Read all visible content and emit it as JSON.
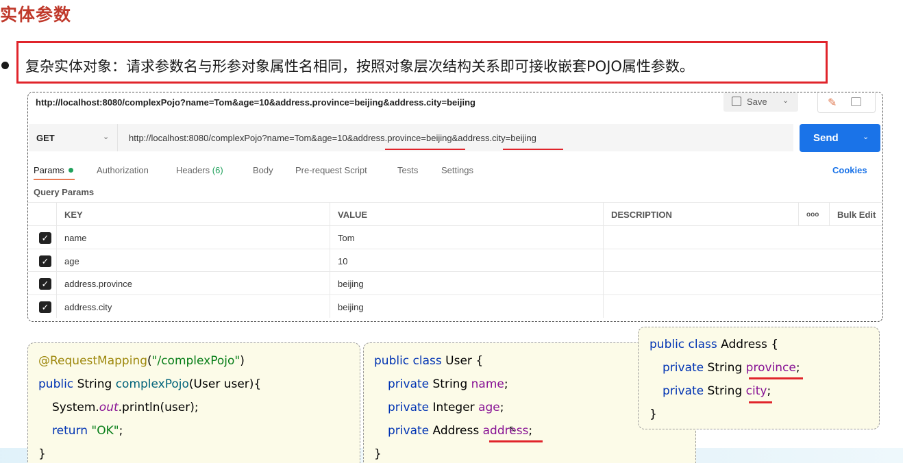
{
  "slide": {
    "title": "实体参数",
    "bullet": "复杂实体对象：请求参数名与形参对象属性名相同，按照对象层次结构关系即可接收嵌套POJO属性参数。"
  },
  "postman": {
    "title_url": "http://localhost:8080/complexPojo?name=Tom&age=10&address.province=beijing&address.city=beijing",
    "save_label": "Save",
    "method": "GET",
    "url_parts": [
      "http://localhost:8080/complexPojo?name=Tom&age=10&",
      "address.province",
      "=beijing&",
      "address.city",
      "=beijing"
    ],
    "send_label": "Send",
    "tabs": {
      "params": "Params",
      "authorization": "Authorization",
      "headers": "Headers",
      "headers_count": "(6)",
      "body": "Body",
      "prerequest": "Pre-request Script",
      "tests": "Tests",
      "settings": "Settings"
    },
    "cookies": "Cookies",
    "query_params_label": "Query Params",
    "table": {
      "headers": {
        "key": "KEY",
        "value": "VALUE",
        "description": "DESCRIPTION",
        "more": "ooo",
        "bulk_edit": "Bulk Edit"
      },
      "rows": [
        {
          "key": "name",
          "value": "Tom",
          "checked": true
        },
        {
          "key": "age",
          "value": "10",
          "checked": true
        },
        {
          "key": "address.province",
          "value": "beijing",
          "checked": true
        },
        {
          "key": "address.city",
          "value": "beijing",
          "checked": true
        }
      ]
    }
  },
  "code_controller": {
    "annotation": "@RequestMapping",
    "mapping_path": "\"/complexPojo\"",
    "kw_public": "public",
    "return_type": "String",
    "method_name": "complexPojo",
    "params": "(User user){",
    "system": "System.",
    "out": "out",
    "println": ".println(user);",
    "kw_return": "return",
    "return_value": "\"OK\"",
    "close": "}"
  },
  "code_user": {
    "decl_kw": "public class",
    "class_name": "User {",
    "kw_private": "private",
    "f1_type": "String",
    "f1_name": "name",
    "f2_type": "Integer",
    "f2_name": "age",
    "f3_type": "Address",
    "f3_name": "address",
    "close": "}"
  },
  "code_address": {
    "decl_kw": "public class",
    "class_name": "Address {",
    "kw_private": "private",
    "f1_type": "String",
    "f1_name": "province",
    "f2_type": "String",
    "f2_name": "city",
    "close": "}"
  },
  "colors": {
    "title_red": "#c0392b",
    "highlight_red": "#e0242b",
    "send_blue": "#1a73e8",
    "code_bg": "#fcfbe8"
  }
}
